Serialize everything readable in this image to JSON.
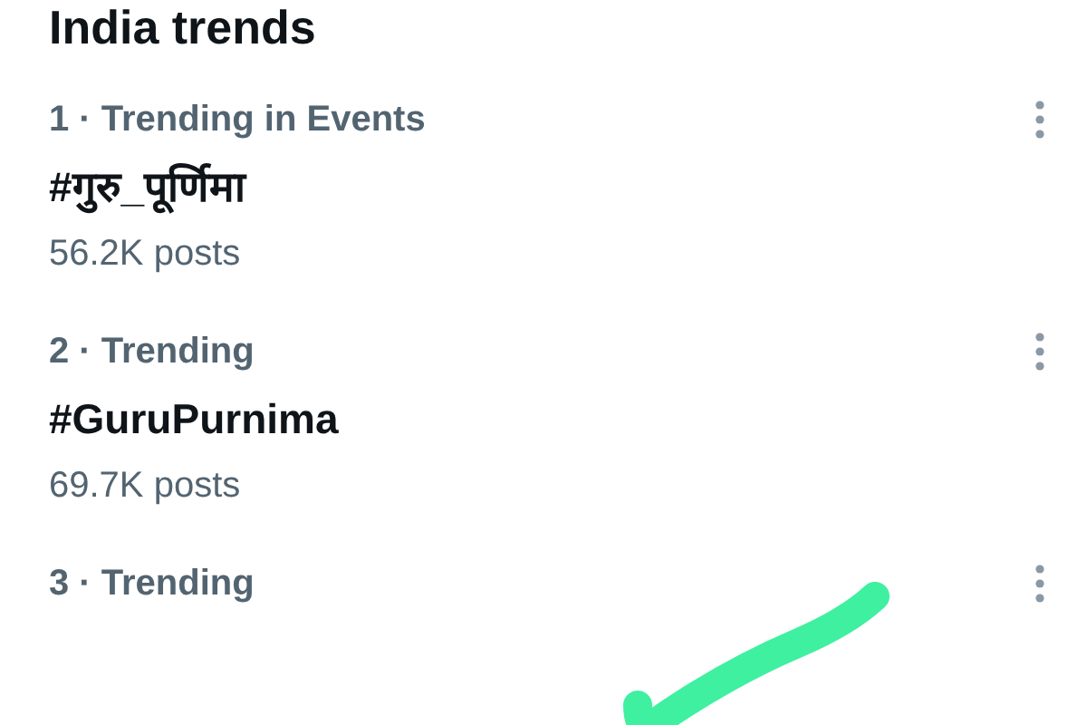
{
  "heading": "India trends",
  "trends": [
    {
      "context": "1 · Trending in Events",
      "title": "#गुरु_पूर्णिमा",
      "posts": "56.2K posts"
    },
    {
      "context": "2 · Trending",
      "title": "#GuruPurnima",
      "posts": "69.7K posts"
    },
    {
      "context": "3 · Trending"
    }
  ]
}
